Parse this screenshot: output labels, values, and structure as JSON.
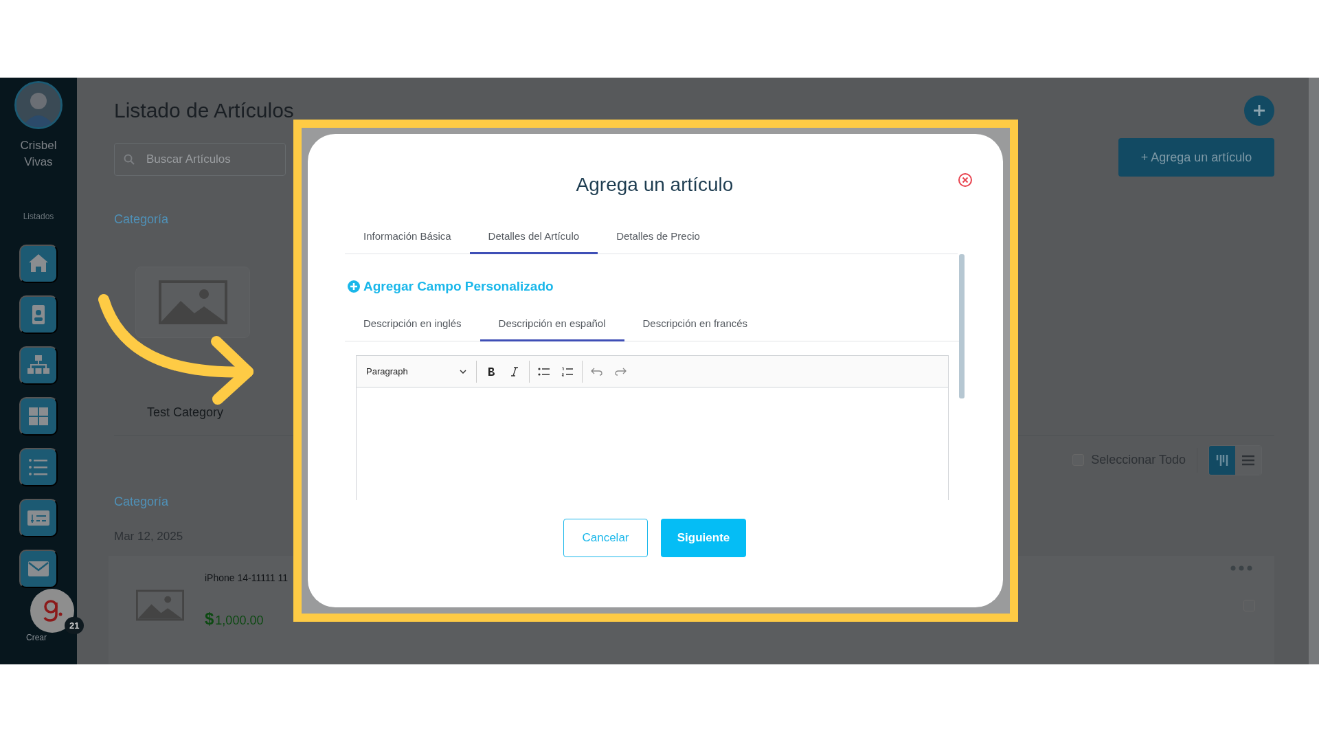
{
  "sidebar": {
    "user_name": "Crisbel Vivas",
    "section_label": "Listados",
    "notification_count": "21",
    "create_label": "Crear"
  },
  "page": {
    "title": "Listado de Artículos",
    "search": {
      "placeholder": "Buscar Artículos"
    },
    "add_button": "+ Agrega un artículo",
    "category_heading": "Categoría",
    "categories": [
      {
        "name": "Test Category"
      }
    ],
    "select_all": {
      "label": "Seleccionar Todo",
      "checked": false
    },
    "view_modes": [
      {
        "kind": "grid",
        "selected": true
      },
      {
        "kind": "list",
        "selected": false
      }
    ],
    "item_section": {
      "heading": "Categoría",
      "date": "Mar 12, 2025",
      "items": [
        {
          "name": "iPhone 14-11111 11",
          "currency": "$",
          "price": "1,000.00",
          "checked": false
        }
      ]
    }
  },
  "modal": {
    "title": "Agrega un artículo",
    "tabs": [
      {
        "label": "Información Básica",
        "selected": false
      },
      {
        "label": "Detalles del Artículo",
        "selected": true
      },
      {
        "label": "Detalles de Precio",
        "selected": false
      }
    ],
    "custom_field_link": "Agregar Campo Personalizado",
    "description_tabs": [
      {
        "label": "Descripción en inglés",
        "selected": false
      },
      {
        "label": "Descripción en español",
        "selected": true
      },
      {
        "label": "Descripción en francés",
        "selected": false
      }
    ],
    "editor": {
      "block_format": "Paragraph"
    },
    "cancel_button": "Cancelar",
    "next_button": "Siguiente"
  }
}
